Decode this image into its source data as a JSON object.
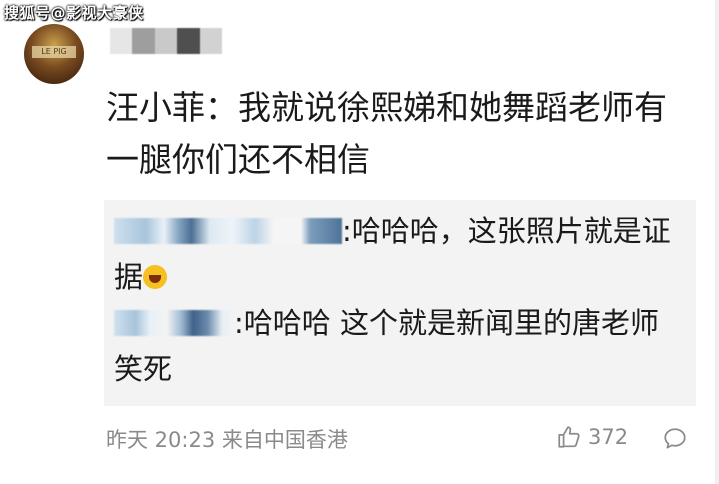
{
  "watermark": "搜狐号@影视大豪侠",
  "comment": {
    "avatar_label": "LE PIG",
    "text": "汪小菲：我就说徐熙娣和她舞蹈老师有一腿你们还不相信"
  },
  "replies": [
    {
      "text": ":哈哈哈，这张照片就是证据"
    },
    {
      "text": ":哈哈哈 这个就是新闻里的唐老师 笑死"
    }
  ],
  "meta": {
    "time": "昨天 20:23",
    "location": "来自中国香港"
  },
  "actions": {
    "like_count": "372"
  },
  "colors": {
    "text": "#1a1a1a",
    "meta": "#8a8a8a",
    "reply_bg": "#f3f3f3"
  },
  "icons": [
    "thumbs-up-icon",
    "comment-icon",
    "laughing-emoji-icon"
  ]
}
